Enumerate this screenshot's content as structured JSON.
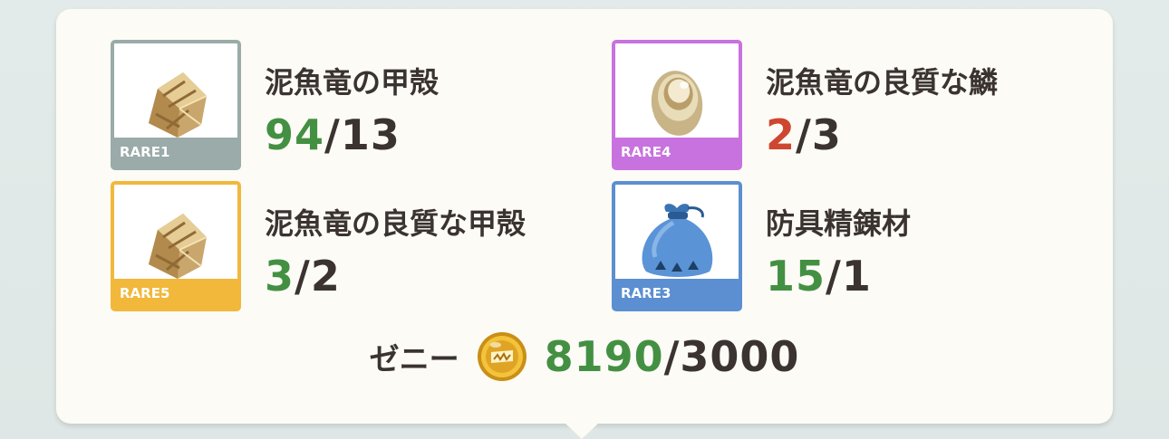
{
  "items": [
    {
      "name": "泥魚竜の甲殻",
      "owned": "94",
      "required": "13",
      "rarity": "RARE1",
      "frame_color": "#9aaba9",
      "owned_color": "#449043",
      "icon": "carapace-icon"
    },
    {
      "name": "泥魚竜の良質な鱗",
      "owned": "2",
      "required": "3",
      "rarity": "RARE4",
      "frame_color": "#c872df",
      "owned_color": "#cf4630",
      "icon": "scale-icon"
    },
    {
      "name": "泥魚竜の良質な甲殻",
      "owned": "3",
      "required": "2",
      "rarity": "RARE5",
      "frame_color": "#f1b83c",
      "owned_color": "#449043",
      "icon": "carapace-icon"
    },
    {
      "name": "防具精錬材",
      "owned": "15",
      "required": "1",
      "rarity": "RARE3",
      "frame_color": "#5b8fd1",
      "owned_color": "#449043",
      "icon": "refining-sack-icon"
    }
  ],
  "zenny": {
    "label": "ゼニー",
    "owned": "8190",
    "required": "3000",
    "owned_color": "#449043",
    "icon": "zenny-coin-icon"
  }
}
